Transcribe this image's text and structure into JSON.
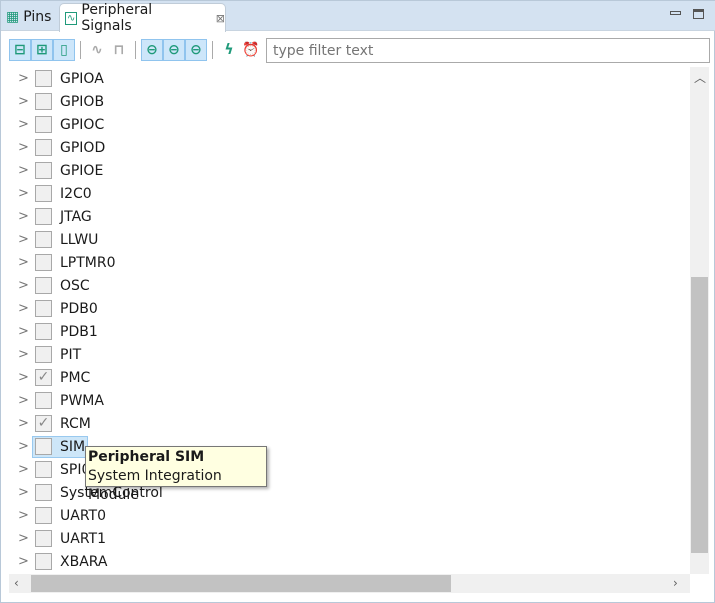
{
  "tabs": [
    {
      "label": "Pins",
      "icon": "table-icon"
    },
    {
      "label": "Peripheral Signals",
      "icon": "signal-icon",
      "close": "⊠"
    }
  ],
  "filter": {
    "placeholder": "type filter text"
  },
  "items": [
    {
      "label": "GPIOA",
      "checked": false
    },
    {
      "label": "GPIOB",
      "checked": false
    },
    {
      "label": "GPIOC",
      "checked": false
    },
    {
      "label": "GPIOD",
      "checked": false
    },
    {
      "label": "GPIOE",
      "checked": false
    },
    {
      "label": "I2C0",
      "checked": false
    },
    {
      "label": "JTAG",
      "checked": false
    },
    {
      "label": "LLWU",
      "checked": false
    },
    {
      "label": "LPTMR0",
      "checked": false
    },
    {
      "label": "OSC",
      "checked": false
    },
    {
      "label": "PDB0",
      "checked": false
    },
    {
      "label": "PDB1",
      "checked": false
    },
    {
      "label": "PIT",
      "checked": false
    },
    {
      "label": "PMC",
      "checked": true
    },
    {
      "label": "PWMA",
      "checked": false
    },
    {
      "label": "RCM",
      "checked": true
    },
    {
      "label": "SIM",
      "checked": false,
      "selected": true
    },
    {
      "label": "SPI0",
      "checked": false
    },
    {
      "label": "SystemControl",
      "checked": false
    },
    {
      "label": "UART0",
      "checked": false
    },
    {
      "label": "UART1",
      "checked": false
    },
    {
      "label": "XBARA",
      "checked": false
    }
  ],
  "tooltip": {
    "title": "Peripheral SIM",
    "text": "System Integration Module"
  },
  "colors": {
    "accent": "#1f9a7a",
    "selection": "#cde6f8",
    "tabbar": "#d4e2f1"
  }
}
